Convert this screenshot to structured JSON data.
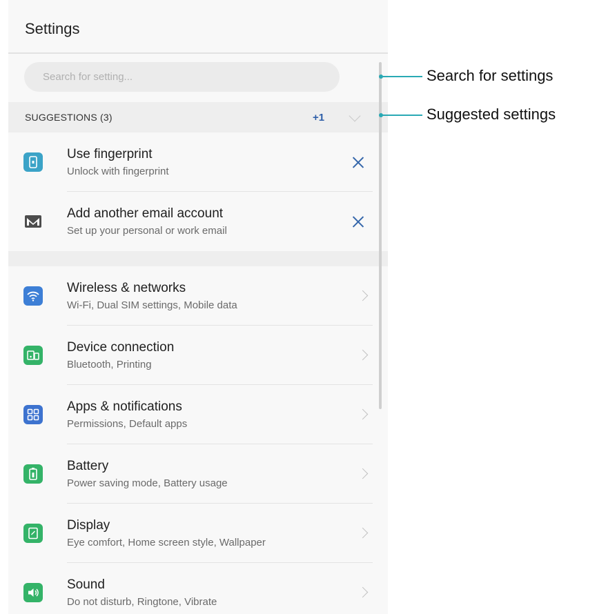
{
  "header": {
    "title": "Settings"
  },
  "search": {
    "placeholder": "Search for setting..."
  },
  "suggestions": {
    "label": "SUGGESTIONS (3)",
    "more": "+1",
    "items": [
      {
        "title": "Use fingerprint",
        "subtitle": "Unlock with fingerprint",
        "icon": "fingerprint-icon",
        "color": "#3ba3c7"
      },
      {
        "title": "Add another email account",
        "subtitle": "Set up your personal or work email",
        "icon": "email-icon",
        "color": "#555555"
      }
    ]
  },
  "settings": {
    "items": [
      {
        "title": "Wireless & networks",
        "subtitle": "Wi-Fi, Dual SIM settings, Mobile data",
        "icon": "wifi-icon",
        "color": "#3d7fd6"
      },
      {
        "title": "Device connection",
        "subtitle": "Bluetooth, Printing",
        "icon": "device-connection-icon",
        "color": "#34b368"
      },
      {
        "title": "Apps & notifications",
        "subtitle": "Permissions, Default apps",
        "icon": "apps-icon",
        "color": "#3d73cf"
      },
      {
        "title": "Battery",
        "subtitle": "Power saving mode, Battery usage",
        "icon": "battery-icon",
        "color": "#34b368"
      },
      {
        "title": "Display",
        "subtitle": "Eye comfort, Home screen style, Wallpaper",
        "icon": "display-icon",
        "color": "#34b368"
      },
      {
        "title": "Sound",
        "subtitle": "Do not disturb, Ringtone, Vibrate",
        "icon": "sound-icon",
        "color": "#34b368"
      }
    ]
  },
  "callouts": {
    "search": "Search for settings",
    "suggested": "Suggested settings"
  },
  "colors": {
    "accent": "#2e5ea8",
    "callout_line": "#29a9b4"
  }
}
